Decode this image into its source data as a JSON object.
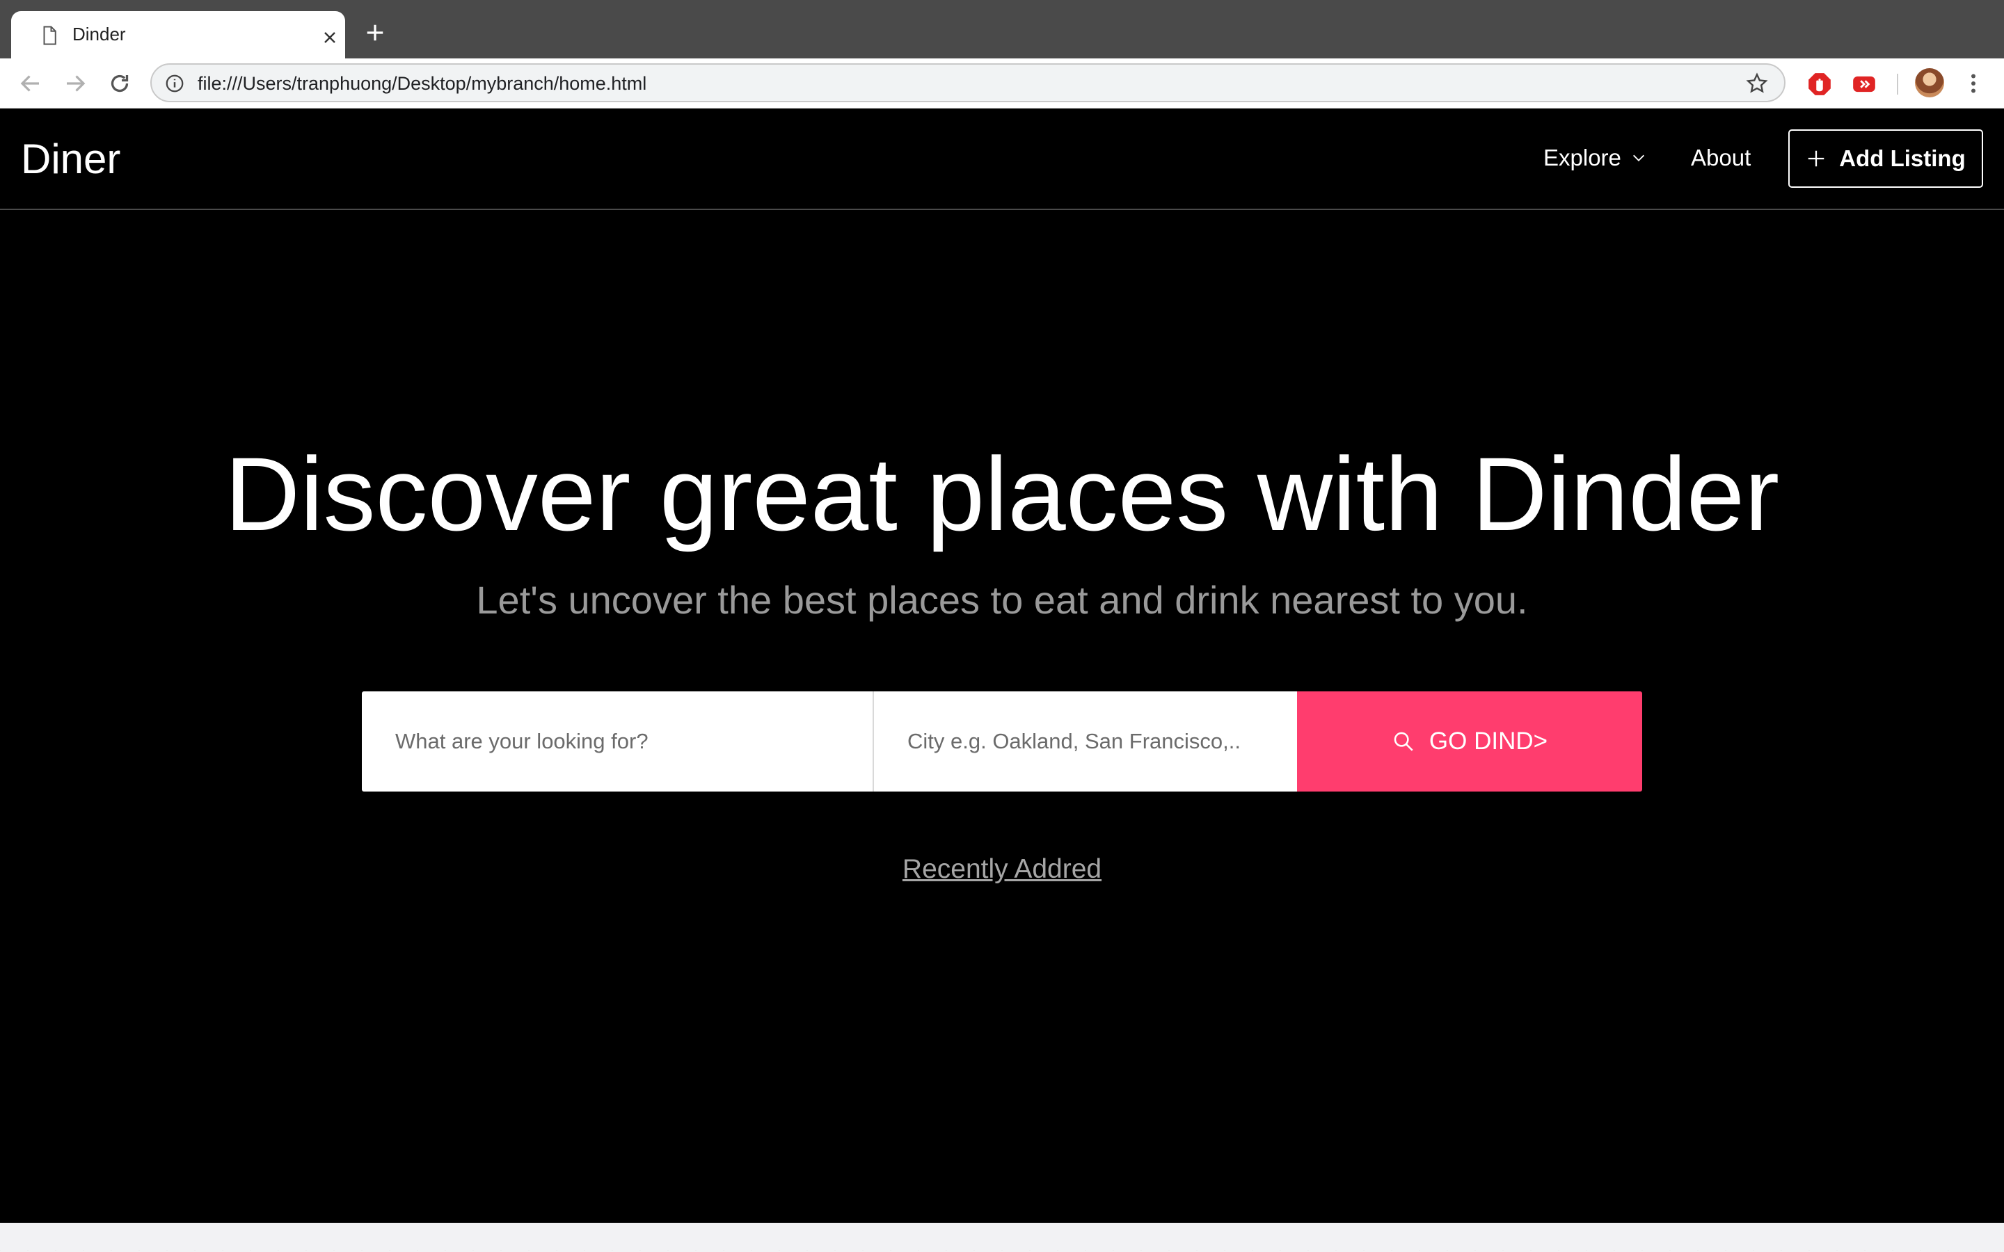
{
  "browser": {
    "tab_title": "Dinder",
    "url": "file:///Users/tranphuong/Desktop/mybranch/home.html"
  },
  "site": {
    "logo": "Diner",
    "nav": {
      "explore": "Explore",
      "about": "About",
      "add_listing": "Add Listing"
    }
  },
  "hero": {
    "title": "Discover great places with Dinder",
    "subtitle": "Let's uncover the best places to eat and drink nearest to you."
  },
  "search": {
    "what_placeholder": "What are your looking for?",
    "city_placeholder": "City e.g. Oakland, San Francisco,..",
    "button_label": "GO DIND>"
  },
  "recent_link": "Recently Addred",
  "colors": {
    "accent": "#ff3d6e",
    "page_background": "#000000",
    "subtitle_text": "#9a9a9a"
  },
  "icons": [
    "doc-icon",
    "close-icon",
    "plus-icon",
    "back-arrow-icon",
    "forward-arrow-icon",
    "reload-icon",
    "info-icon",
    "star-icon",
    "adblock-icon",
    "youtube-icon",
    "avatar",
    "kebab-menu-icon",
    "chevron-down-icon",
    "search-icon"
  ]
}
